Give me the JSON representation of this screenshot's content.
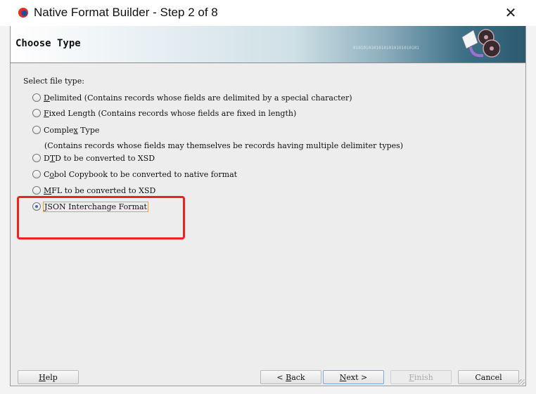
{
  "window": {
    "title": "Native Format Builder - Step 2 of 8",
    "close_icon": "close-icon",
    "app_icon": "oracle-icon"
  },
  "header": {
    "title": "Choose Type",
    "binary": "01010101010101010101010101"
  },
  "content": {
    "label": "Select file type:",
    "options": [
      {
        "pre": "",
        "key": "D",
        "post": "elimited (Contains records whose fields are delimited by a special character)",
        "selected": false
      },
      {
        "pre": "",
        "key": "F",
        "post": "ixed Length (Contains records whose fields are fixed in length)",
        "selected": false
      },
      {
        "pre": "Comple",
        "key": "x",
        "post": " Type",
        "selected": false
      },
      {
        "pre": "D",
        "key": "T",
        "post": "D to be converted to XSD",
        "selected": false
      },
      {
        "pre": "C",
        "key": "o",
        "post": "bol Copybook to be converted to native format",
        "selected": false
      },
      {
        "pre": "",
        "key": "M",
        "post": "FL to be converted to XSD",
        "selected": false
      },
      {
        "pre": "",
        "key": "J",
        "post": "SON Interchange Format",
        "selected": true
      }
    ],
    "complex_note": "(Contains records whose fields may themselves be records having multiple delimiter types)",
    "highlight_color": "#e8261f"
  },
  "buttons": {
    "help": {
      "key": "H",
      "post": "elp"
    },
    "back": {
      "pre": "< ",
      "key": "B",
      "post": "ack"
    },
    "next": {
      "key": "N",
      "post": "ext >"
    },
    "finish": {
      "key": "F",
      "post": "inish",
      "disabled": true
    },
    "cancel": {
      "label": "Cancel"
    }
  }
}
